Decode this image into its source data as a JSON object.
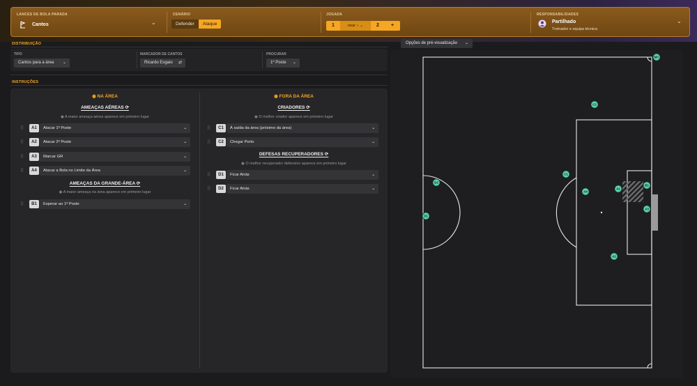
{
  "header": {
    "set_piece": {
      "title": "LANCES DE BOLA PARADA",
      "value": "Cantos"
    },
    "scenario": {
      "title": "CENÁRIO",
      "options": [
        "Defender",
        "Ataque"
      ],
      "selected": "Ataque"
    },
    "play": {
      "title": "JOGADA",
      "first": "1",
      "middle": "near",
      "second": "2",
      "add": "+"
    },
    "responsibilities": {
      "title": "RESPONSABILIDADES",
      "value": "Partilhado",
      "sub": "Treinador e equipa técnica"
    }
  },
  "distribution": {
    "label": "DISTRIBUIÇÃO",
    "type": {
      "title": "TIPO",
      "value": "Cantos para a área"
    },
    "taker": {
      "title": "MARCADOR DE CANTOS",
      "value": "Ricardo Esgaio"
    },
    "search": {
      "title": "PROCURAR",
      "value": "1º Poste"
    }
  },
  "instructions": {
    "label": "INSTRUÇÕES",
    "inside": {
      "title": "NA ÁREA",
      "aerial": {
        "title": "AMEAÇAS AÉREAS",
        "hint": "A maior ameaça aérea aparece em primeiro lugar",
        "rows": [
          {
            "badge": "A1",
            "value": "Atacar 1º Poste"
          },
          {
            "badge": "A2",
            "value": "Atacar 2º Poste"
          },
          {
            "badge": "A3",
            "value": "Marcar GR"
          },
          {
            "badge": "A4",
            "value": "Atacar a Bola no Limite da Área"
          }
        ]
      },
      "box": {
        "title": "AMEAÇAS DA GRANDE-ÁREA",
        "hint": "A maior ameaça na área aparece em primeiro lugar",
        "rows": [
          {
            "badge": "B1",
            "value": "Esperar ao 1º Poste"
          }
        ]
      }
    },
    "outside": {
      "title": "FORA DA ÁREA",
      "creators": {
        "title": "CRIADORES",
        "hint": "O melhor criador aparece em primeiro lugar",
        "rows": [
          {
            "badge": "C1",
            "value": "À saída da área (próximo da área)"
          },
          {
            "badge": "C2",
            "value": "Chegar Perto"
          }
        ]
      },
      "recovery": {
        "title": "DEFESAS RECUPERADORES",
        "hint": "O melhor recuperador defensivo aparece em primeiro lugar",
        "rows": [
          {
            "badge": "D1",
            "value": "Ficar Atrás"
          },
          {
            "badge": "D2",
            "value": "Ficar Atrás"
          }
        ]
      }
    }
  },
  "preview": {
    "button": "Opções de pré-visualização",
    "players": [
      "MC",
      "C2",
      "C1",
      "A4",
      "A1",
      "B1",
      "A3",
      "A2",
      "D2",
      "D1"
    ]
  },
  "colors": {
    "accent": "#f5a623",
    "player": "#5fd0a8"
  }
}
